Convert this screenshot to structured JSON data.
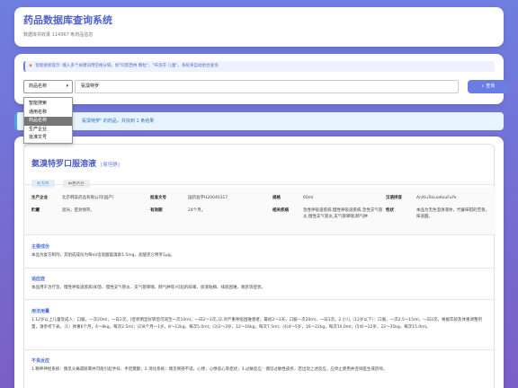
{
  "header": {
    "title": "药品数据库查询系统",
    "subtitle": "数据库共收录 114367 条药品信息"
  },
  "search": {
    "tip_label": "智能搜索提示:",
    "tip_text": "输入多个关键词用空格分隔，如\"阿莫西林 颗粒\"、\"布洛芬 儿童\"，系统将自动组合查询",
    "select_value": "商品名称",
    "input_value": "氨溴特罗",
    "query_label": "查询",
    "options": [
      "智能搜索",
      "通用名称",
      "商品名称",
      "生产企业",
      "批准文号"
    ]
  },
  "banner": {
    "text": "氨溴特罗\" 的药品，共找到 1 条结果"
  },
  "result": {
    "name": "氨溴特罗口服溶液",
    "tag": "[易坦静]",
    "chips": [
      "处方药",
      "中西药品"
    ],
    "fields": {
      "maker_k": "生产企业",
      "maker_v": "北京韩美药品有限公司(国产)",
      "approval_k": "批准文号",
      "approval_v": "国药准字H20040317",
      "spec_k": "规格",
      "spec_v": "60ml",
      "pinyin_k": "汉语拼音",
      "pinyin_v": "AnXiuTeLuoKouFuYe",
      "storage_k": "贮藏",
      "storage_v": "遮光，密封保存。",
      "valid_k": "有效期",
      "valid_v": "24个月。",
      "disease_k": "相关疾病",
      "disease_v": "急性呼吸道疾病,慢性呼吸道疾病,急性支气管炎,慢性支气管炎,支气管哮喘,肺气肿",
      "trait_k": "性状",
      "trait_v": "本品为无色澄清液体，代餐味钳的苦香，味道甜。"
    },
    "sections": [
      {
        "title": "主要成份",
        "text": "本品为复方制剂，其组成成份为每ml含盐酸氨溴索1.5mg，盐酸克仑特罗1μg。"
      },
      {
        "title": "适应症",
        "text": "本品用于治疗急、慢性呼吸道疾病(如急、慢性支气管炎、支气管哮喘、肺气肿等)引起的咳嗽、痰液粘稠、排痰困难、喘息等症状。"
      },
      {
        "title": "用法用量",
        "text": "1.12岁以上儿童及成人：口服，一次20ml，一日2次。[症状明显好转后可减至一次10ml，一日2～3次。]2.对严重呼吸困难患者，最初2～3天，口服一次20ml，一日3次。2.小儿（12岁以下）：口服，一次2.5～15ml，一日2次，根据年龄及体重调整剂量，请参考下表。（1）体重6个月，4～8kg，每次2.5ml；(2)8个月～1岁，8～12kg，每次5.0ml；(3)2～3岁，12～16kg，每次7.5ml；(4)4～5岁，16～22kg，每次10.0ml；(5)6～12岁，22～35kg，每次15.0ml。"
      },
      {
        "title": "不良反应",
        "text": "1.精神神经系统：偶见头痛或眩晕并可能引起手抖、手足震颤；2.消化系统：偶见胃部不适，心悸，心悸恶心等症状；3.过敏反应：偶见过敏性皮疹，若出现上述反应，应停止使用并咨询医生或药师。"
      }
    ]
  }
}
